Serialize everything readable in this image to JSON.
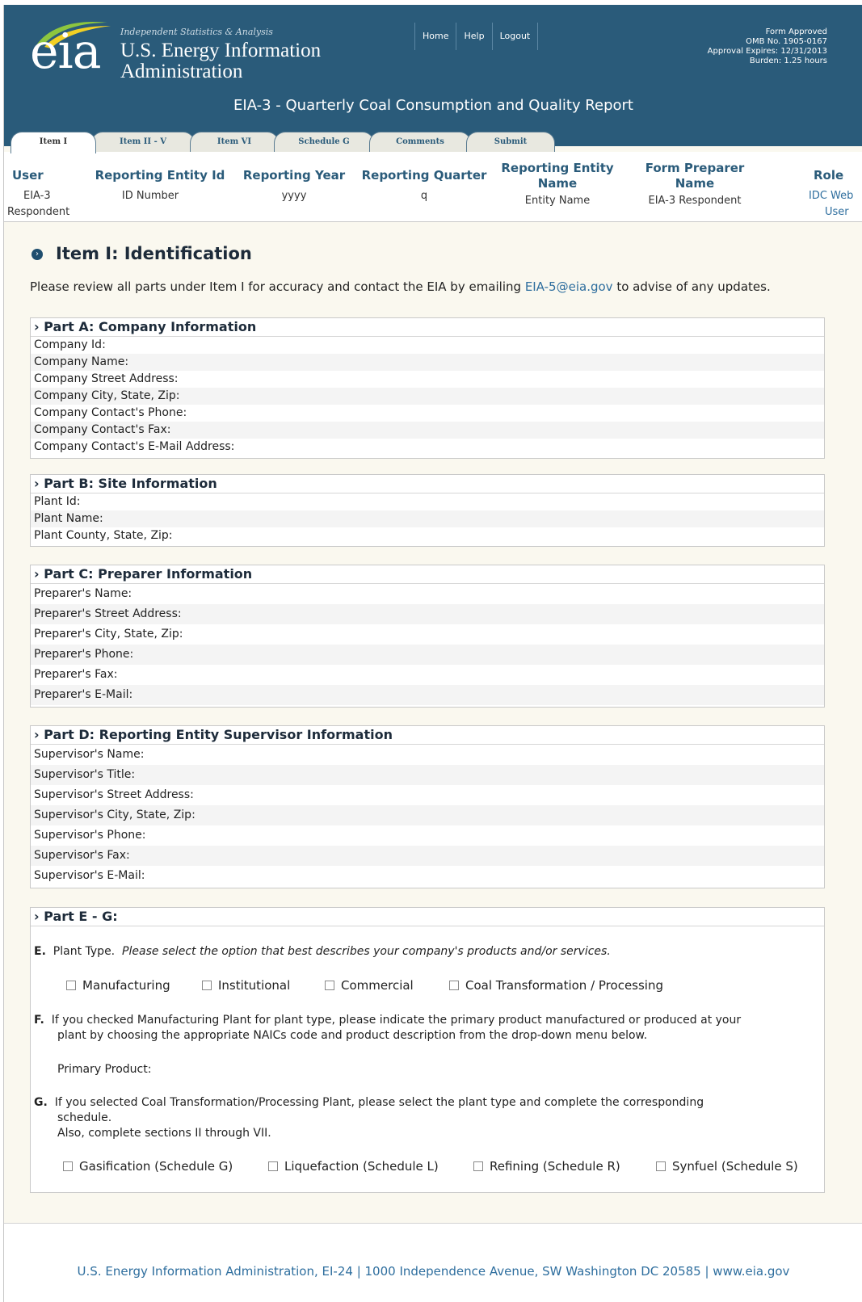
{
  "brand": {
    "wordmark": "eia",
    "tagline": "Independent Statistics & Analysis",
    "name_line1": "U.S. Energy Information",
    "name_line2": "Administration",
    "colors": {
      "header_bg": "#2a5b7a",
      "swoosh_green": "#8dc63f",
      "swoosh_yellow": "#f2d024",
      "link": "#2e6e9e"
    }
  },
  "topnav": {
    "home": "Home",
    "help": "Help",
    "logout": "Logout"
  },
  "approval": {
    "line1": "Form Approved",
    "line2": "OMB No. 1905-0167",
    "line3": "Approval Expires: 12/31/2013",
    "line4": "Burden: 1.25 hours"
  },
  "form_title": "EIA-3 - Quarterly Coal Consumption and Quality Report",
  "tabs": [
    {
      "label": "Item I",
      "active": true
    },
    {
      "label": "Item II - V"
    },
    {
      "label": "Item VI"
    },
    {
      "label": "Schedule G"
    },
    {
      "label": "Comments"
    },
    {
      "label": "Submit"
    }
  ],
  "info": {
    "headers": {
      "user": "User",
      "entity_id": "Reporting Entity Id",
      "year": "Reporting Year",
      "quarter": "Reporting Quarter",
      "entity_name_1": "Reporting Entity",
      "entity_name_2": "Name",
      "preparer_1": "Form Preparer",
      "preparer_2": "Name",
      "role": "Role"
    },
    "values": {
      "user_1": "EIA-3",
      "user_2": "Respondent",
      "entity_id": "ID Number",
      "year": "yyyy",
      "quarter": "q",
      "entity_name": "Entity Name",
      "preparer": "EIA-3 Respondent",
      "role_1": "IDC Web",
      "role_2": "User"
    }
  },
  "section": {
    "title": "Item I: Identification",
    "intro_before": "Please review all parts under Item I for accuracy and contact the EIA by emailing ",
    "intro_link": "EIA-5@eia.gov",
    "intro_after": " to advise of any updates."
  },
  "parts": {
    "a": {
      "title": "Part A: Company Information",
      "rows": [
        "Company Id:",
        "Company Name:",
        "Company Street Address:",
        "Company City, State, Zip:",
        "Company Contact's Phone:",
        "Company Contact's Fax:",
        "Company Contact's E-Mail Address:"
      ]
    },
    "b": {
      "title": "Part B: Site Information",
      "rows": [
        "Plant Id:",
        "Plant Name:",
        "Plant County, State, Zip:"
      ]
    },
    "c": {
      "title": "Part C: Preparer Information",
      "rows": [
        "Preparer's Name:",
        "Preparer's Street Address:",
        "Preparer's City, State, Zip:",
        "Preparer's Phone:",
        "Preparer's Fax:",
        "Preparer's E-Mail:"
      ]
    },
    "d": {
      "title": "Part D: Reporting Entity Supervisor Information",
      "rows": [
        "Supervisor's Name:",
        "Supervisor's Title:",
        "Supervisor's Street Address:",
        "Supervisor's City, State, Zip:",
        "Supervisor's Phone:",
        "Supervisor's Fax:",
        "Supervisor's E-Mail:"
      ]
    },
    "eg": {
      "title": "Part E - G:",
      "e_letter": "E.",
      "e_text": "Plant Type.",
      "e_italic": "Please select the option that best describes your company's products and/or services.",
      "plant_types": [
        "Manufacturing",
        "Institutional",
        "Commercial",
        "Coal Transformation / Processing"
      ],
      "f_letter": "F.",
      "f_line1": "If you checked Manufacturing Plant for plant type, please indicate the primary product manufactured or produced at your",
      "f_line2": "plant by choosing the appropriate NAICs code and product description from the drop-down menu below.",
      "primary_product_label": "Primary Product:",
      "g_letter": "G.",
      "g_line1": "If you selected Coal Transformation/Processing Plant, please select the plant type and complete the corresponding",
      "g_line2": "schedule.",
      "g_line3": "Also, complete sections II through VII.",
      "schedules": [
        "Gasification (Schedule G)",
        "Liquefaction (Schedule L)",
        "Refining (Schedule R)",
        "Synfuel (Schedule S)"
      ]
    }
  },
  "footer": "U.S. Energy Information Administration, EI-24 | 1000 Independence Avenue, SW Washington DC 20585  | www.eia.gov"
}
